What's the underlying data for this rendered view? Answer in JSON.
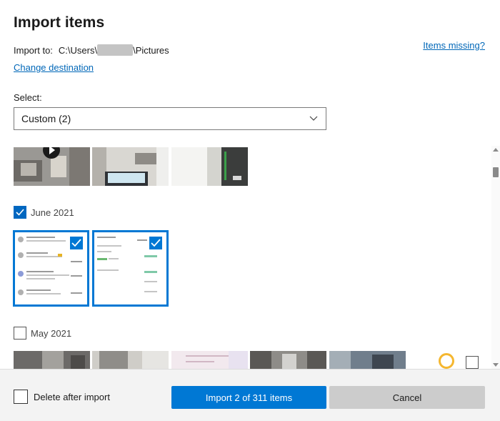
{
  "dialog": {
    "title": "Import items",
    "import_to_label": "Import to:",
    "path_prefix": "C:\\Users\\",
    "path_suffix": "\\Pictures",
    "change_destination": "Change destination",
    "items_missing": "Items missing?"
  },
  "select": {
    "label": "Select:",
    "value": "Custom (2)"
  },
  "groups": [
    {
      "label": "June 2021",
      "checked": true,
      "photos_selected": 2
    },
    {
      "label": "May 2021",
      "checked": false
    }
  ],
  "footer": {
    "delete_after_import": "Delete after import",
    "import_button": "Import 2 of 311 items",
    "cancel_button": "Cancel"
  },
  "colors": {
    "accent": "#0078d4",
    "link": "#0067b8",
    "footer_bg": "#f3f3f3",
    "cancel_bg": "#cccccc"
  }
}
